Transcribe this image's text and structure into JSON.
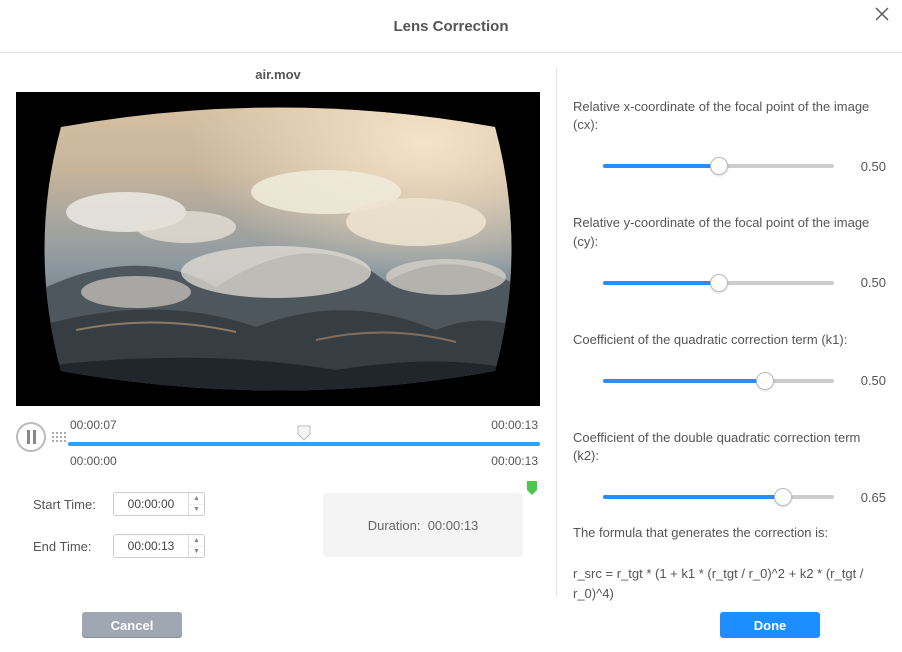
{
  "title": "Lens Correction",
  "filename": "air.mov",
  "playback": {
    "state": "paused",
    "icon": "pause-icon",
    "trim_start_label": "00:00:07",
    "trim_end_label": "00:00:13",
    "range_start_label": "00:00:00",
    "range_end_label": "00:00:13",
    "playhead_pct": 50,
    "fill_start_pct": 0,
    "fill_end_pct": 100
  },
  "time": {
    "start_label": "Start Time:",
    "start_value": "00:00:00",
    "end_label": "End Time:",
    "end_value": "00:00:13"
  },
  "duration": {
    "label": "Duration:",
    "value": "00:00:13"
  },
  "params": {
    "cx": {
      "label": "Relative x-coordinate of the focal point of the image (cx):",
      "value": "0.50",
      "pct": 50
    },
    "cy": {
      "label": "Relative y-coordinate of the focal point of the image (cy):",
      "value": "0.50",
      "pct": 50
    },
    "k1": {
      "label": "Coefficient of the quadratic correction term (k1):",
      "value": "0.50",
      "pct": 70
    },
    "k2": {
      "label": "Coefficient of the double quadratic correction term (k2):",
      "value": "0.65",
      "pct": 78
    }
  },
  "formula": {
    "intro": "The formula that generates the correction is:",
    "body": "r_src = r_tgt * (1 + k1 * (r_tgt / r_0)^2 + k2 * (r_tgt / r_0)^4)"
  },
  "buttons": {
    "cancel": "Cancel",
    "done": "Done"
  }
}
